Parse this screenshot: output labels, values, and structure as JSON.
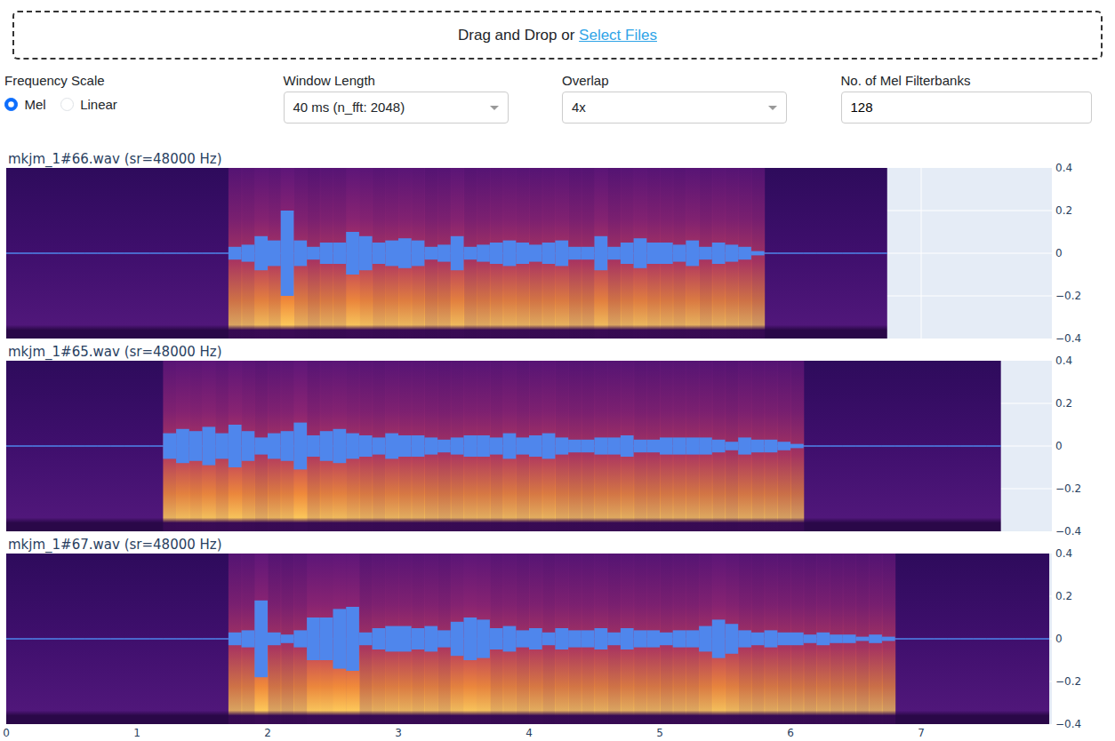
{
  "upload": {
    "prompt": "Drag and Drop or ",
    "link": "Select Files"
  },
  "controls": {
    "frequency_scale": {
      "label": "Frequency Scale",
      "options": [
        {
          "label": "Mel",
          "selected": true
        },
        {
          "label": "Linear",
          "selected": false
        }
      ]
    },
    "window_length": {
      "label": "Window Length",
      "value": "40 ms (n_fft: 2048)"
    },
    "overlap": {
      "label": "Overlap",
      "value": "4x"
    },
    "mel_filterbanks": {
      "label": "No. of Mel Filterbanks",
      "value": "128"
    }
  },
  "chart": {
    "x_ticks": [
      "0",
      "1",
      "2",
      "3",
      "4",
      "5",
      "6",
      "7"
    ],
    "y_ticks": [
      "0.4",
      "0.2",
      "0",
      "−0.2",
      "−0.4"
    ],
    "x_range": [
      0,
      8
    ],
    "y_range": [
      -0.4,
      0.4
    ],
    "bin_seconds": 0.1,
    "plots": [
      {
        "title": "mkjm_1#66.wav (sr=48000 Hz)",
        "duration": 6.74,
        "envelope": [
          0.002,
          0.002,
          0.002,
          0.002,
          0.002,
          0.002,
          0.002,
          0.002,
          0.002,
          0.002,
          0.002,
          0.002,
          0.002,
          0.002,
          0.002,
          0.002,
          0.002,
          0.03,
          0.04,
          0.08,
          0.06,
          0.2,
          0.06,
          0.03,
          0.05,
          0.05,
          0.1,
          0.08,
          0.05,
          0.06,
          0.07,
          0.06,
          0.03,
          0.04,
          0.08,
          0.03,
          0.04,
          0.05,
          0.06,
          0.05,
          0.04,
          0.05,
          0.06,
          0.03,
          0.03,
          0.08,
          0.03,
          0.05,
          0.07,
          0.05,
          0.05,
          0.04,
          0.06,
          0.03,
          0.05,
          0.04,
          0.03,
          0.01,
          0.002,
          0.002,
          0.002,
          0.002,
          0.002,
          0.002,
          0.002,
          0.002,
          0.002,
          0.002
        ]
      },
      {
        "title": "mkjm_1#65.wav (sr=48000 Hz)",
        "duration": 7.61,
        "envelope": [
          0.002,
          0.002,
          0.002,
          0.002,
          0.002,
          0.002,
          0.002,
          0.002,
          0.002,
          0.002,
          0.002,
          0.002,
          0.06,
          0.08,
          0.07,
          0.09,
          0.06,
          0.1,
          0.07,
          0.04,
          0.06,
          0.07,
          0.11,
          0.05,
          0.07,
          0.08,
          0.06,
          0.05,
          0.04,
          0.06,
          0.05,
          0.05,
          0.04,
          0.03,
          0.04,
          0.05,
          0.05,
          0.04,
          0.06,
          0.04,
          0.05,
          0.06,
          0.04,
          0.03,
          0.03,
          0.04,
          0.04,
          0.05,
          0.03,
          0.03,
          0.04,
          0.04,
          0.04,
          0.04,
          0.03,
          0.02,
          0.04,
          0.03,
          0.03,
          0.02,
          0.01,
          0.002,
          0.002,
          0.002,
          0.002,
          0.002,
          0.002,
          0.002,
          0.002,
          0.002,
          0.002,
          0.002,
          0.002,
          0.002,
          0.002,
          0.002,
          0.002
        ]
      },
      {
        "title": "mkjm_1#67.wav (sr=48000 Hz)",
        "duration": 7.98,
        "envelope": [
          0.002,
          0.002,
          0.002,
          0.002,
          0.002,
          0.002,
          0.002,
          0.002,
          0.002,
          0.002,
          0.002,
          0.002,
          0.002,
          0.002,
          0.002,
          0.002,
          0.002,
          0.03,
          0.04,
          0.18,
          0.03,
          0.02,
          0.04,
          0.1,
          0.1,
          0.14,
          0.15,
          0.03,
          0.05,
          0.06,
          0.06,
          0.05,
          0.06,
          0.04,
          0.08,
          0.1,
          0.09,
          0.05,
          0.06,
          0.04,
          0.05,
          0.03,
          0.05,
          0.04,
          0.04,
          0.05,
          0.03,
          0.05,
          0.04,
          0.04,
          0.03,
          0.04,
          0.04,
          0.06,
          0.09,
          0.07,
          0.04,
          0.03,
          0.04,
          0.03,
          0.03,
          0.02,
          0.03,
          0.02,
          0.02,
          0.01,
          0.02,
          0.01,
          0.002,
          0.002,
          0.002,
          0.002,
          0.002,
          0.002,
          0.002,
          0.002,
          0.002,
          0.002,
          0.002,
          0.002
        ]
      }
    ]
  }
}
